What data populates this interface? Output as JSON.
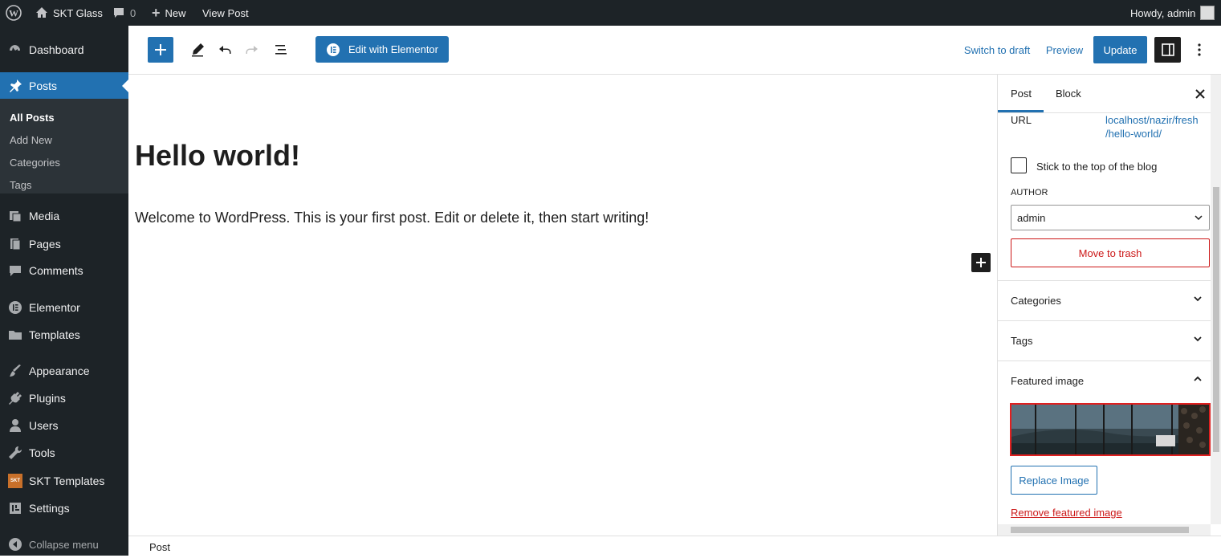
{
  "adminbar": {
    "site_name": "SKT Glass",
    "comments_count": "0",
    "new_label": "New",
    "view_post": "View Post",
    "howdy": "Howdy, admin"
  },
  "sidebar": {
    "items": [
      {
        "label": "Dashboard",
        "icon": "dashboard-icon"
      },
      {
        "label": "Posts",
        "icon": "pin-icon"
      },
      {
        "label": "Media",
        "icon": "media-icon"
      },
      {
        "label": "Pages",
        "icon": "pages-icon"
      },
      {
        "label": "Comments",
        "icon": "comment-icon"
      },
      {
        "label": "Elementor",
        "icon": "elementor-icon"
      },
      {
        "label": "Templates",
        "icon": "folder-icon"
      },
      {
        "label": "Appearance",
        "icon": "brush-icon"
      },
      {
        "label": "Plugins",
        "icon": "plugin-icon"
      },
      {
        "label": "Users",
        "icon": "user-icon"
      },
      {
        "label": "Tools",
        "icon": "wrench-icon"
      },
      {
        "label": "SKT Templates",
        "icon": "skt-icon"
      },
      {
        "label": "Settings",
        "icon": "settings-icon"
      }
    ],
    "submenu": [
      "All Posts",
      "Add New",
      "Categories",
      "Tags"
    ],
    "collapse": "Collapse menu",
    "skt_badge": "SKT"
  },
  "toolbar": {
    "elementor_label": "Edit with Elementor",
    "switch_draft": "Switch to draft",
    "preview": "Preview",
    "update": "Update"
  },
  "post": {
    "title": "Hello world!",
    "body": "Welcome to WordPress. This is your first post. Edit or delete it, then start writing!"
  },
  "panel": {
    "tabs": [
      "Post",
      "Block"
    ],
    "url_label": "URL",
    "url_line1": "localhost/nazir/fresh",
    "url_line2": "/hello-world/",
    "sticky_label": "Stick to the top of the blog",
    "author_label": "AUTHOR",
    "author_value": "admin",
    "trash_label": "Move to trash",
    "categories": "Categories",
    "tags": "Tags",
    "featured": "Featured image",
    "replace": "Replace Image",
    "remove": "Remove featured image"
  },
  "footer": {
    "breadcrumb": "Post"
  },
  "colors": {
    "admin_dark": "#1d2327",
    "accent": "#2271b1",
    "danger": "#cc1818",
    "highlight": "#e02020"
  }
}
